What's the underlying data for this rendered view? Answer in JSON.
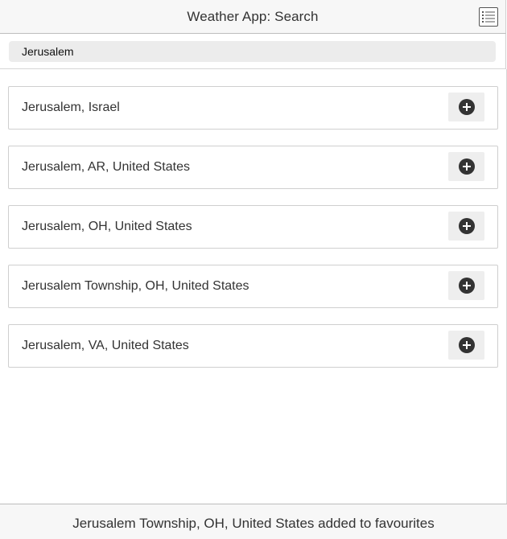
{
  "header": {
    "title": "Weather App: Search",
    "menu_icon": "list-icon"
  },
  "search": {
    "value": "Jerusalem",
    "placeholder": ""
  },
  "results": [
    {
      "label": "Jerusalem, Israel",
      "action_icon": "plus-circle-icon"
    },
    {
      "label": "Jerusalem, AR, United States",
      "action_icon": "plus-circle-icon"
    },
    {
      "label": "Jerusalem, OH, United States",
      "action_icon": "plus-circle-icon"
    },
    {
      "label": "Jerusalem Township, OH, United States",
      "action_icon": "plus-circle-icon"
    },
    {
      "label": "Jerusalem, VA, United States",
      "action_icon": "plus-circle-icon"
    }
  ],
  "footer": {
    "message": "Jerusalem Township, OH, United States added to favourites"
  },
  "colors": {
    "header_bg": "#f7f7f7",
    "row_border": "#cfcfcf",
    "button_bg": "#eeeeee",
    "icon": "#333333"
  }
}
